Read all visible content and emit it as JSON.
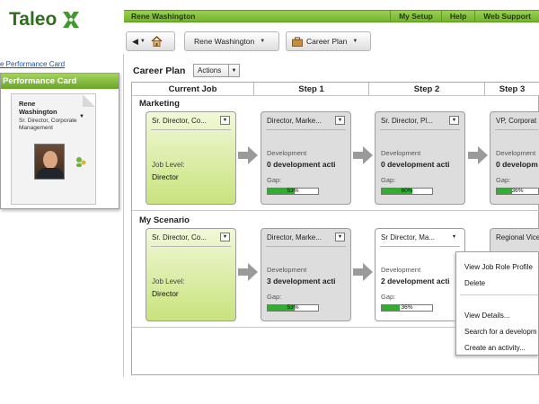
{
  "app": {
    "logo_text": "Taleo"
  },
  "topbar": {
    "user": "Rene Washington",
    "links": [
      "My Setup",
      "Help",
      "Web Support"
    ]
  },
  "toolbar": {
    "person_button": "Rene Washington",
    "career_plan_button": "Career Plan"
  },
  "left": {
    "link": "e Performance Card",
    "panel_title": "Performance Card",
    "card": {
      "name_line1": "Rene",
      "name_line2": "Washington",
      "title": "Sr. Director, Corporate Management"
    }
  },
  "main": {
    "title": "Career Plan",
    "actions_label": "Actions",
    "columns": [
      "Current Job",
      "Step 1",
      "Step 2",
      "Step 3"
    ],
    "sections": [
      {
        "name": "Marketing",
        "current": {
          "title": "Sr. Director, Co...",
          "job_level_label": "Job Level:",
          "job_level": "Director"
        },
        "steps": [
          {
            "title": "Director, Marke...",
            "dev_label": "Development",
            "activities": "0 development acti",
            "gap_label": "Gap:",
            "gap": "53%",
            "gap_value": 53
          },
          {
            "title": "Sr. Director, Pl...",
            "dev_label": "Development",
            "activities": "0 development acti",
            "gap_label": "Gap:",
            "gap": "60%",
            "gap_value": 60
          },
          {
            "title": "VP, Corporat",
            "dev_label": "Development",
            "activities": "0 developm",
            "gap_label": "Gap:",
            "gap": "36%",
            "gap_value": 36
          }
        ]
      },
      {
        "name": "My Scenario",
        "current": {
          "title": "Sr. Director, Co...",
          "job_level_label": "Job Level:",
          "job_level": "Director"
        },
        "steps": [
          {
            "title": "Director, Marke...",
            "dev_label": "Development",
            "activities": "3 development acti",
            "gap_label": "Gap:",
            "gap": "53%",
            "gap_value": 53
          },
          {
            "title": "Sr Director, Ma...",
            "dev_label": "Development",
            "activities": "2 development acti",
            "gap_label": "Gap:",
            "gap": "36%",
            "gap_value": 36
          },
          {
            "title": "Regional Vice"
          }
        ]
      }
    ]
  },
  "context_menu": {
    "items": [
      "View Job Role Profile",
      "Delete",
      "View Details...",
      "Search for a developm",
      "Create an activity..."
    ]
  },
  "colors": {
    "brand_green": "#2f6e1e",
    "bar_green": "#74b22e",
    "gap_fill": "#2fae2f",
    "current_job": "#c9e37d"
  }
}
